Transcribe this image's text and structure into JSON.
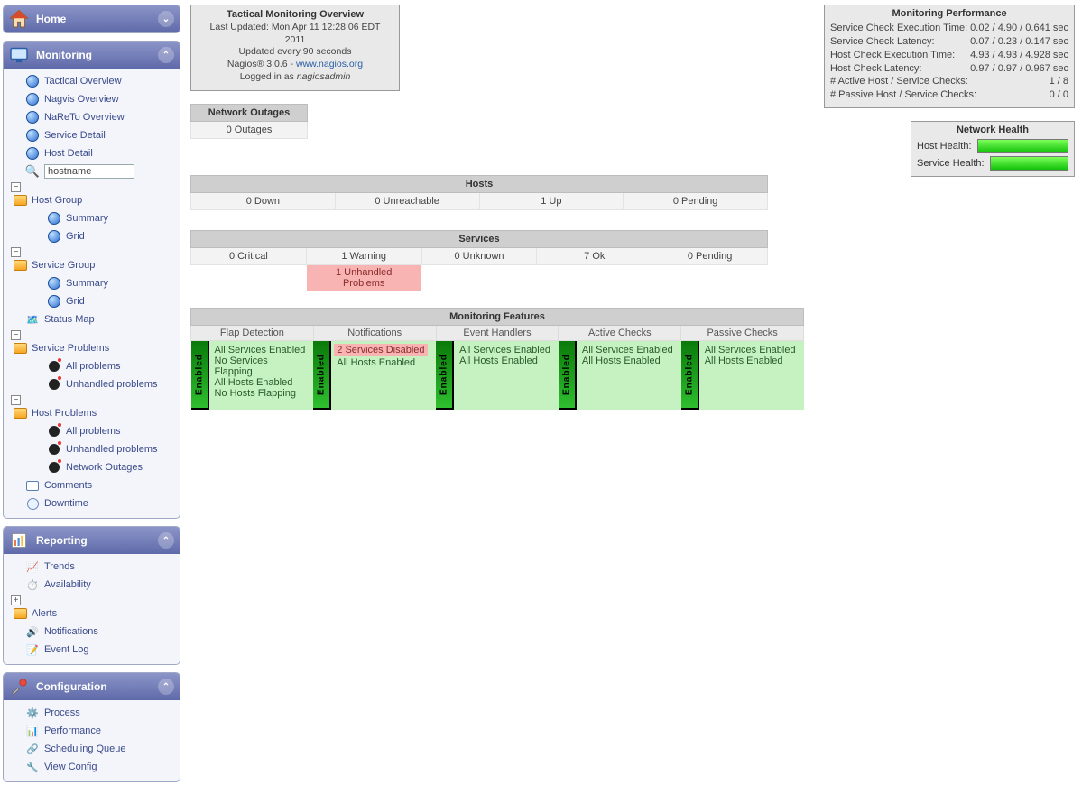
{
  "sidebar": {
    "home": {
      "label": "Home"
    },
    "monitoring": {
      "label": "Monitoring",
      "items": {
        "tactical": "Tactical Overview",
        "nagvis": "Nagvis Overview",
        "nareto": "NaReTo Overview",
        "service_detail": "Service Detail",
        "host_detail": "Host Detail",
        "hostname_placeholder": "hostname",
        "host_group": "Host Group",
        "summary": "Summary",
        "grid": "Grid",
        "service_group": "Service Group",
        "status_map": "Status Map",
        "service_problems": "Service Problems",
        "all_problems": "All problems",
        "unhandled_problems": "Unhandled problems",
        "host_problems": "Host Problems",
        "network_outages": "Network Outages",
        "comments": "Comments",
        "downtime": "Downtime"
      }
    },
    "reporting": {
      "label": "Reporting",
      "trends": "Trends",
      "availability": "Availability",
      "alerts": "Alerts",
      "notifications": "Notifications",
      "event_log": "Event Log"
    },
    "configuration": {
      "label": "Configuration",
      "process": "Process",
      "performance": "Performance",
      "scheduling_queue": "Scheduling Queue",
      "view_config": "View Config"
    }
  },
  "overview": {
    "title": "Tactical Monitoring Overview",
    "last_updated": "Last Updated: Mon Apr 11 12:28:06 EDT 2011",
    "refresh": "Updated every 90 seconds",
    "nagios_line_prefix": "Nagios® 3.0.6 - ",
    "nagios_link": "www.nagios.org",
    "logged_in_prefix": "Logged in as ",
    "logged_in_user": "nagiosadmin"
  },
  "outages": {
    "header": "Network Outages",
    "value": "0 Outages"
  },
  "hosts": {
    "header": "Hosts",
    "down": "0 Down",
    "unreachable": "0 Unreachable",
    "up": "1 Up",
    "pending": "0 Pending"
  },
  "services": {
    "header": "Services",
    "critical": "0 Critical",
    "warning": "1 Warning",
    "unknown": "0 Unknown",
    "ok": "7 Ok",
    "pending": "0 Pending",
    "unhandled": "1 Unhandled Problems"
  },
  "features": {
    "header": "Monitoring Features",
    "enabled_label": "Enabled",
    "cols": {
      "flap": {
        "label": "Flap Detection",
        "lines": [
          "All Services Enabled",
          "No Services Flapping",
          "All Hosts Enabled",
          "No Hosts Flapping"
        ]
      },
      "notif": {
        "label": "Notifications",
        "disabled_line": "2 Services Disabled",
        "lines": [
          "All Hosts Enabled"
        ]
      },
      "event": {
        "label": "Event Handlers",
        "lines": [
          "All Services Enabled",
          "All Hosts Enabled"
        ]
      },
      "active": {
        "label": "Active Checks",
        "lines": [
          "All Services Enabled",
          "All Hosts Enabled"
        ]
      },
      "passive": {
        "label": "Passive Checks",
        "lines": [
          "All Services Enabled",
          "All Hosts Enabled"
        ]
      }
    }
  },
  "perf": {
    "title": "Monitoring Performance",
    "rows": [
      {
        "k": "Service Check Execution Time:",
        "v": "0.02 / 4.90 / 0.641 sec"
      },
      {
        "k": "Service Check Latency:",
        "v": "0.07 / 0.23 / 0.147 sec"
      },
      {
        "k": "Host Check Execution Time:",
        "v": "4.93 / 4.93 / 4.928 sec"
      },
      {
        "k": "Host Check Latency:",
        "v": "0.97 / 0.97 / 0.967 sec"
      },
      {
        "k": "# Active Host / Service Checks:",
        "v": "1 / 8"
      },
      {
        "k": "# Passive Host / Service Checks:",
        "v": "0 / 0"
      }
    ]
  },
  "health": {
    "title": "Network Health",
    "host_label": "Host Health:",
    "service_label": "Service Health:"
  }
}
